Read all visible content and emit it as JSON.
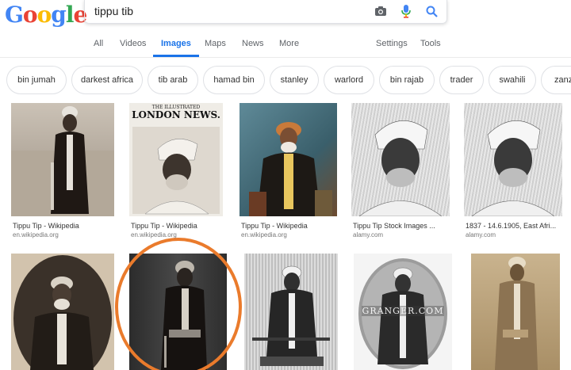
{
  "search": {
    "query": "tippu tib"
  },
  "tabs": [
    {
      "label": "All"
    },
    {
      "label": "Videos"
    },
    {
      "label": "Images"
    },
    {
      "label": "Maps"
    },
    {
      "label": "News"
    },
    {
      "label": "More"
    },
    {
      "label": "Settings"
    },
    {
      "label": "Tools"
    }
  ],
  "chips": [
    "bin jumah",
    "darkest africa",
    "tib arab",
    "hamad bin",
    "stanley",
    "warlord",
    "bin rajab",
    "trader",
    "swahili",
    "zanzi"
  ],
  "results_row1": [
    {
      "title": "Tippu Tip - Wikipedia",
      "source": "en.wikipedia.org"
    },
    {
      "title": "Tippu Tip - Wikipedia",
      "source": "en.wikipedia.org"
    },
    {
      "title": "Tippu Tip - Wikipedia",
      "source": "en.wikipedia.org"
    },
    {
      "title": "Tippu Tip Stock Images ...",
      "source": "alamy.com"
    },
    {
      "title": "1837 - 14.6.1905, East Afri...",
      "source": "alamy.com"
    }
  ],
  "thumb_text": {
    "newspaper_top": "THE ILLUSTRATED",
    "newspaper_name": "LONDON NEWS.",
    "watermark": "GRANGER.COM"
  },
  "colors": {
    "accent": "#1a73e8",
    "annotation": "#ea7b2c"
  }
}
